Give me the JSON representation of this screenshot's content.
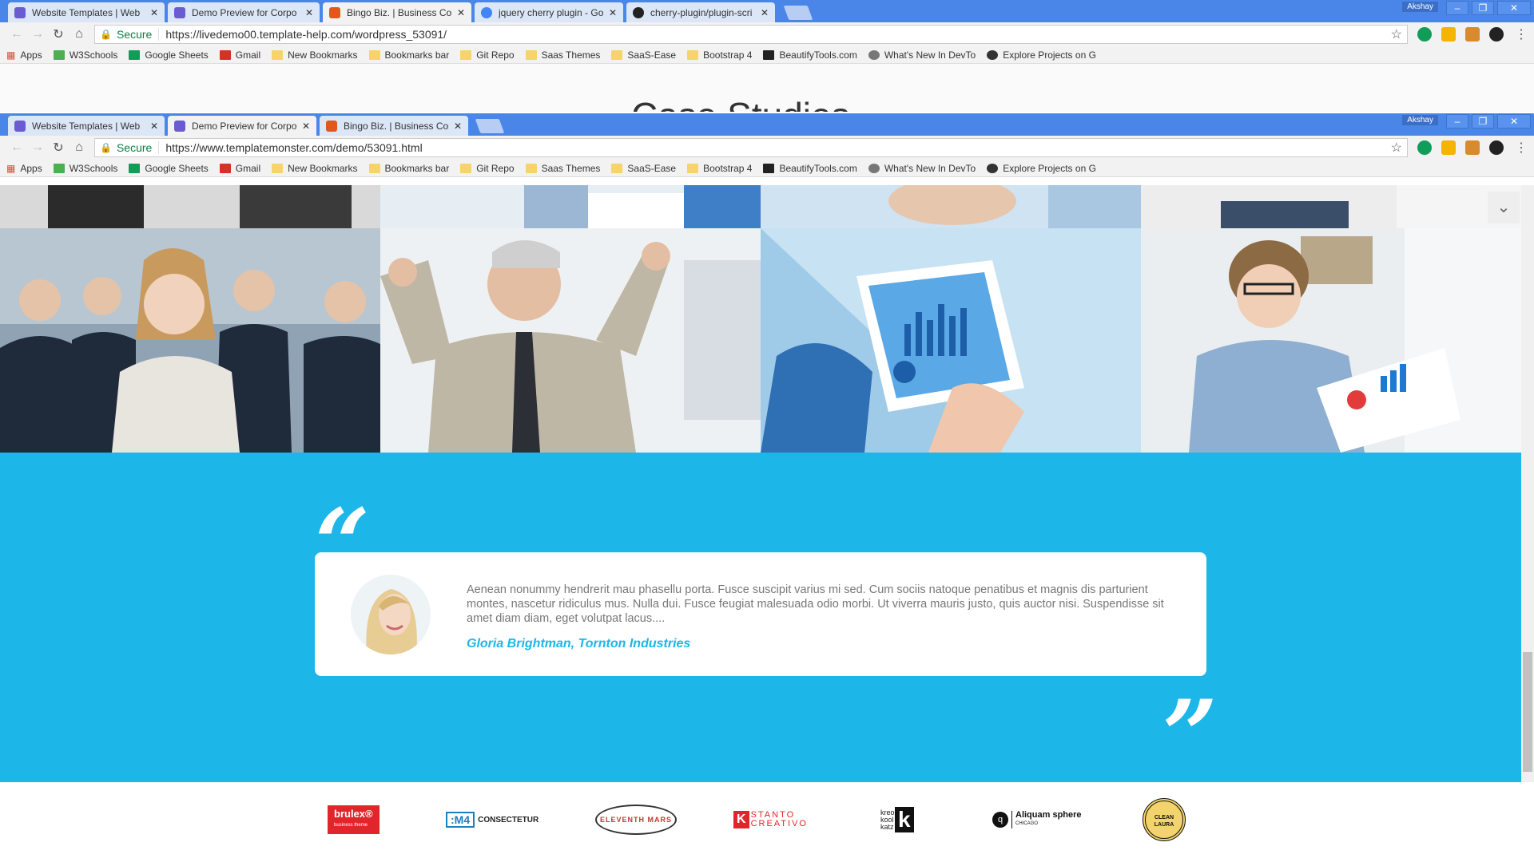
{
  "back_window": {
    "tabs": [
      {
        "title": "Website Templates | Web"
      },
      {
        "title": "Demo Preview for Corpo"
      },
      {
        "title": "Bingo Biz. | Business Con"
      },
      {
        "title": "jquery cherry plugin - Go"
      },
      {
        "title": "cherry-plugin/plugin-scri"
      }
    ],
    "user": "Akshay",
    "secure_label": "Secure",
    "url": "https://livedemo00.template-help.com/wordpress_53091/",
    "peek_heading": "Case Studies"
  },
  "front_window": {
    "tabs": [
      {
        "title": "Website Templates | Web"
      },
      {
        "title": "Demo Preview for Corpo"
      },
      {
        "title": "Bingo Biz. | Business Con"
      }
    ],
    "user": "Akshay",
    "secure_label": "Secure",
    "url": "https://www.templatemonster.com/demo/53091.html"
  },
  "bookmarks": [
    "Apps",
    "W3Schools",
    "Google Sheets",
    "Gmail",
    "New Bookmarks",
    "Bookmarks bar",
    "Git Repo",
    "Saas Themes",
    "SaaS-Ease",
    "Bootstrap 4",
    "BeautifyTools.com",
    "What's New In DevTo",
    "Explore Projects on G"
  ],
  "window_controls": {
    "minimize": "–",
    "restore": "❐",
    "close": "✕"
  },
  "testimonial": {
    "quote": "Aenean nonummy hendrerit mau phasellu porta. Fusce suscipit varius mi sed. Cum sociis natoque penatibus et magnis dis parturient montes, nascetur ridiculus mus. Nulla dui. Fusce feugiat malesuada odio morbi. Ut viverra mauris justo, quis auctor nisi. Suspendisse sit amet diam diam, eget volutpat lacus....",
    "author": "Gloria Brightman, Tornton Industries",
    "open_quote": "“",
    "close_quote": "”"
  },
  "logos": [
    {
      "name": "brulex",
      "text": "brulex®",
      "sub": "business theme"
    },
    {
      "name": "m4",
      "text": ":M4",
      "sub": "CONSECTETUR"
    },
    {
      "name": "eleventh-mars",
      "text": "ELEVENTH MARS"
    },
    {
      "name": "stanto-creativo",
      "text": "STANTO",
      "sub": "CREATIVO"
    },
    {
      "name": "kreo-kool-katz",
      "text": "kreo kool katz"
    },
    {
      "name": "aliquam-sphere",
      "text": "Aliquam sphere",
      "sub": "CHICAGO"
    },
    {
      "name": "clean-laura",
      "text": "CLEAN LAURA"
    }
  ],
  "colors": {
    "accent": "#1cb6e8",
    "chrome": "#4a86e8"
  },
  "icons": {
    "scroll_down": "chevron-down-icon"
  }
}
